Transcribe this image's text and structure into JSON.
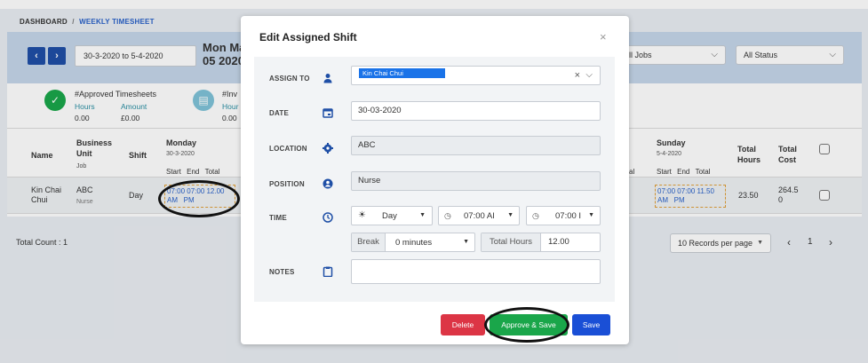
{
  "breadcrumb": {
    "root": "DASHBOARD",
    "sep": "/",
    "current": "WEEKLY TIMESHEET"
  },
  "toolbar": {
    "prev": "‹",
    "next": "›",
    "date_range": "30-3-2020 to 5-4-2020",
    "week_line1": "Mon Ma",
    "week_line2": "05 2020",
    "jobs_filter": "ll Jobs",
    "status_filter": "All Status"
  },
  "summary": {
    "approved_title": "#Approved Timesheets",
    "hours_label": "Hours",
    "amount_label": "Amount",
    "hours_value": "0.00",
    "amount_value": "£0.00",
    "invoice_title": "#Inv",
    "invoice_hours_label": "Hour",
    "invoice_value": "0.00"
  },
  "table": {
    "headers": {
      "name": "Name",
      "business_unit_1": "Business",
      "business_unit_2": "Unit",
      "job": "Job",
      "shift": "Shift",
      "monday": "Monday",
      "monday_date": "30-3-2020",
      "sub_start": "Start",
      "sub_end": "End",
      "sub_total": "Total",
      "sat_fragment": "al",
      "sunday": "Sunday",
      "sunday_date": "5-4-2020",
      "total_hours_1": "Total",
      "total_hours_2": "Hours",
      "total_cost_1": "Total",
      "total_cost_2": "Cost"
    },
    "row": {
      "name_1": "Kin Chai",
      "name_2": "Chui",
      "bu": "ABC",
      "job": "Nurse",
      "shift": "Day",
      "mon_line1": "07:00 07:00 12.00",
      "mon_line2": "AM   PM",
      "sun_line1": "07:00 07:00 11.50",
      "sun_line2": "AM   PM",
      "total_hours": "23.50",
      "total_cost_1": "264.5",
      "total_cost_2": "0"
    }
  },
  "footer": {
    "total_count": "Total Count : 1",
    "records_per_page": "10 Records per page",
    "page_prev": "‹",
    "page_num": "1",
    "page_next": "›"
  },
  "modal": {
    "title": "Edit Assigned Shift",
    "close": "×",
    "assign_label": "ASSIGN TO",
    "assign_value": "Kin Chai Chui",
    "date_label": "DATE",
    "date_value": "30-03-2020",
    "location_label": "LOCATION",
    "location_value": "ABC",
    "position_label": "POSITION",
    "position_value": "Nurse",
    "time_label": "TIME",
    "day_value": "Day",
    "start_value": "07:00 AI",
    "end_value": "07:00 I",
    "break_label": "Break",
    "break_value": "0 minutes",
    "total_hours_label": "Total Hours",
    "total_hours_value": "12.00",
    "notes_label": "NOTES",
    "notes_value": "",
    "delete_label": "Delete",
    "approve_label": "Approve & Save",
    "save_label": "Save"
  },
  "colors": {
    "primary": "#1f4fa6",
    "success": "#1aa64a",
    "danger": "#dc3545",
    "save": "#1a4fd6"
  }
}
